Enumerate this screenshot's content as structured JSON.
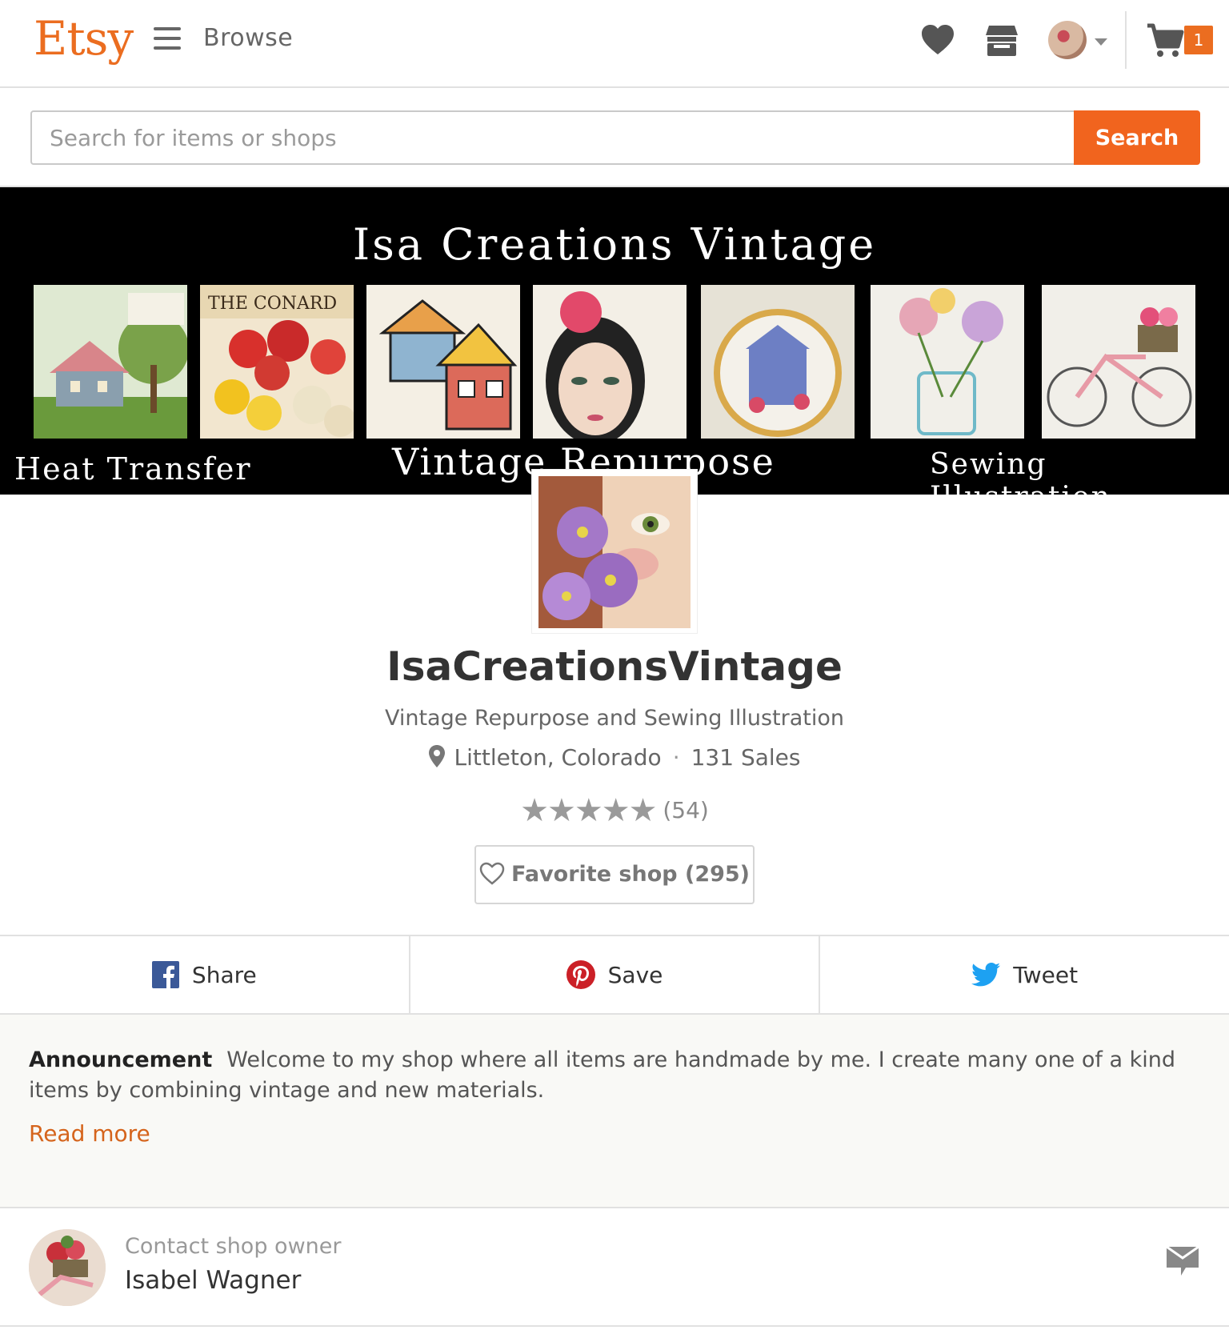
{
  "header": {
    "logo": "Etsy",
    "browse_label": "Browse",
    "cart_count": "1",
    "icons": [
      "menu-icon",
      "heart-icon",
      "shop-icon",
      "avatar",
      "cart-icon"
    ]
  },
  "search": {
    "placeholder": "Search for items or shops",
    "value": "",
    "button_label": "Search"
  },
  "banner": {
    "title": "Isa Creations Vintage",
    "captions": [
      "Heat Transfer",
      "Vintage Repurpose",
      "Sewing Illustration"
    ]
  },
  "shop": {
    "name": "IsaCreationsVintage",
    "tagline": "Vintage Repurpose and Sewing Illustration",
    "location": "Littleton, Colorado",
    "sales": "131 Sales",
    "stars": "★★★★★",
    "rating_value": 5,
    "review_count": "(54)",
    "favorite_label": "Favorite shop (295)"
  },
  "share": {
    "facebook": "Share",
    "pinterest": "Save",
    "twitter": "Tweet"
  },
  "announcement": {
    "label": "Announcement",
    "text": "Welcome to my shop where all items are handmade by me. I create many one of a kind items by combining vintage and new materials.",
    "read_more": "Read more"
  },
  "contact": {
    "label": "Contact shop owner",
    "owner_name": "Isabel Wagner"
  },
  "colors": {
    "brand_orange": "#f1641e",
    "link_orange": "#d5641c",
    "facebook": "#3b5998",
    "pinterest": "#cb2027",
    "twitter": "#1da1f2"
  }
}
